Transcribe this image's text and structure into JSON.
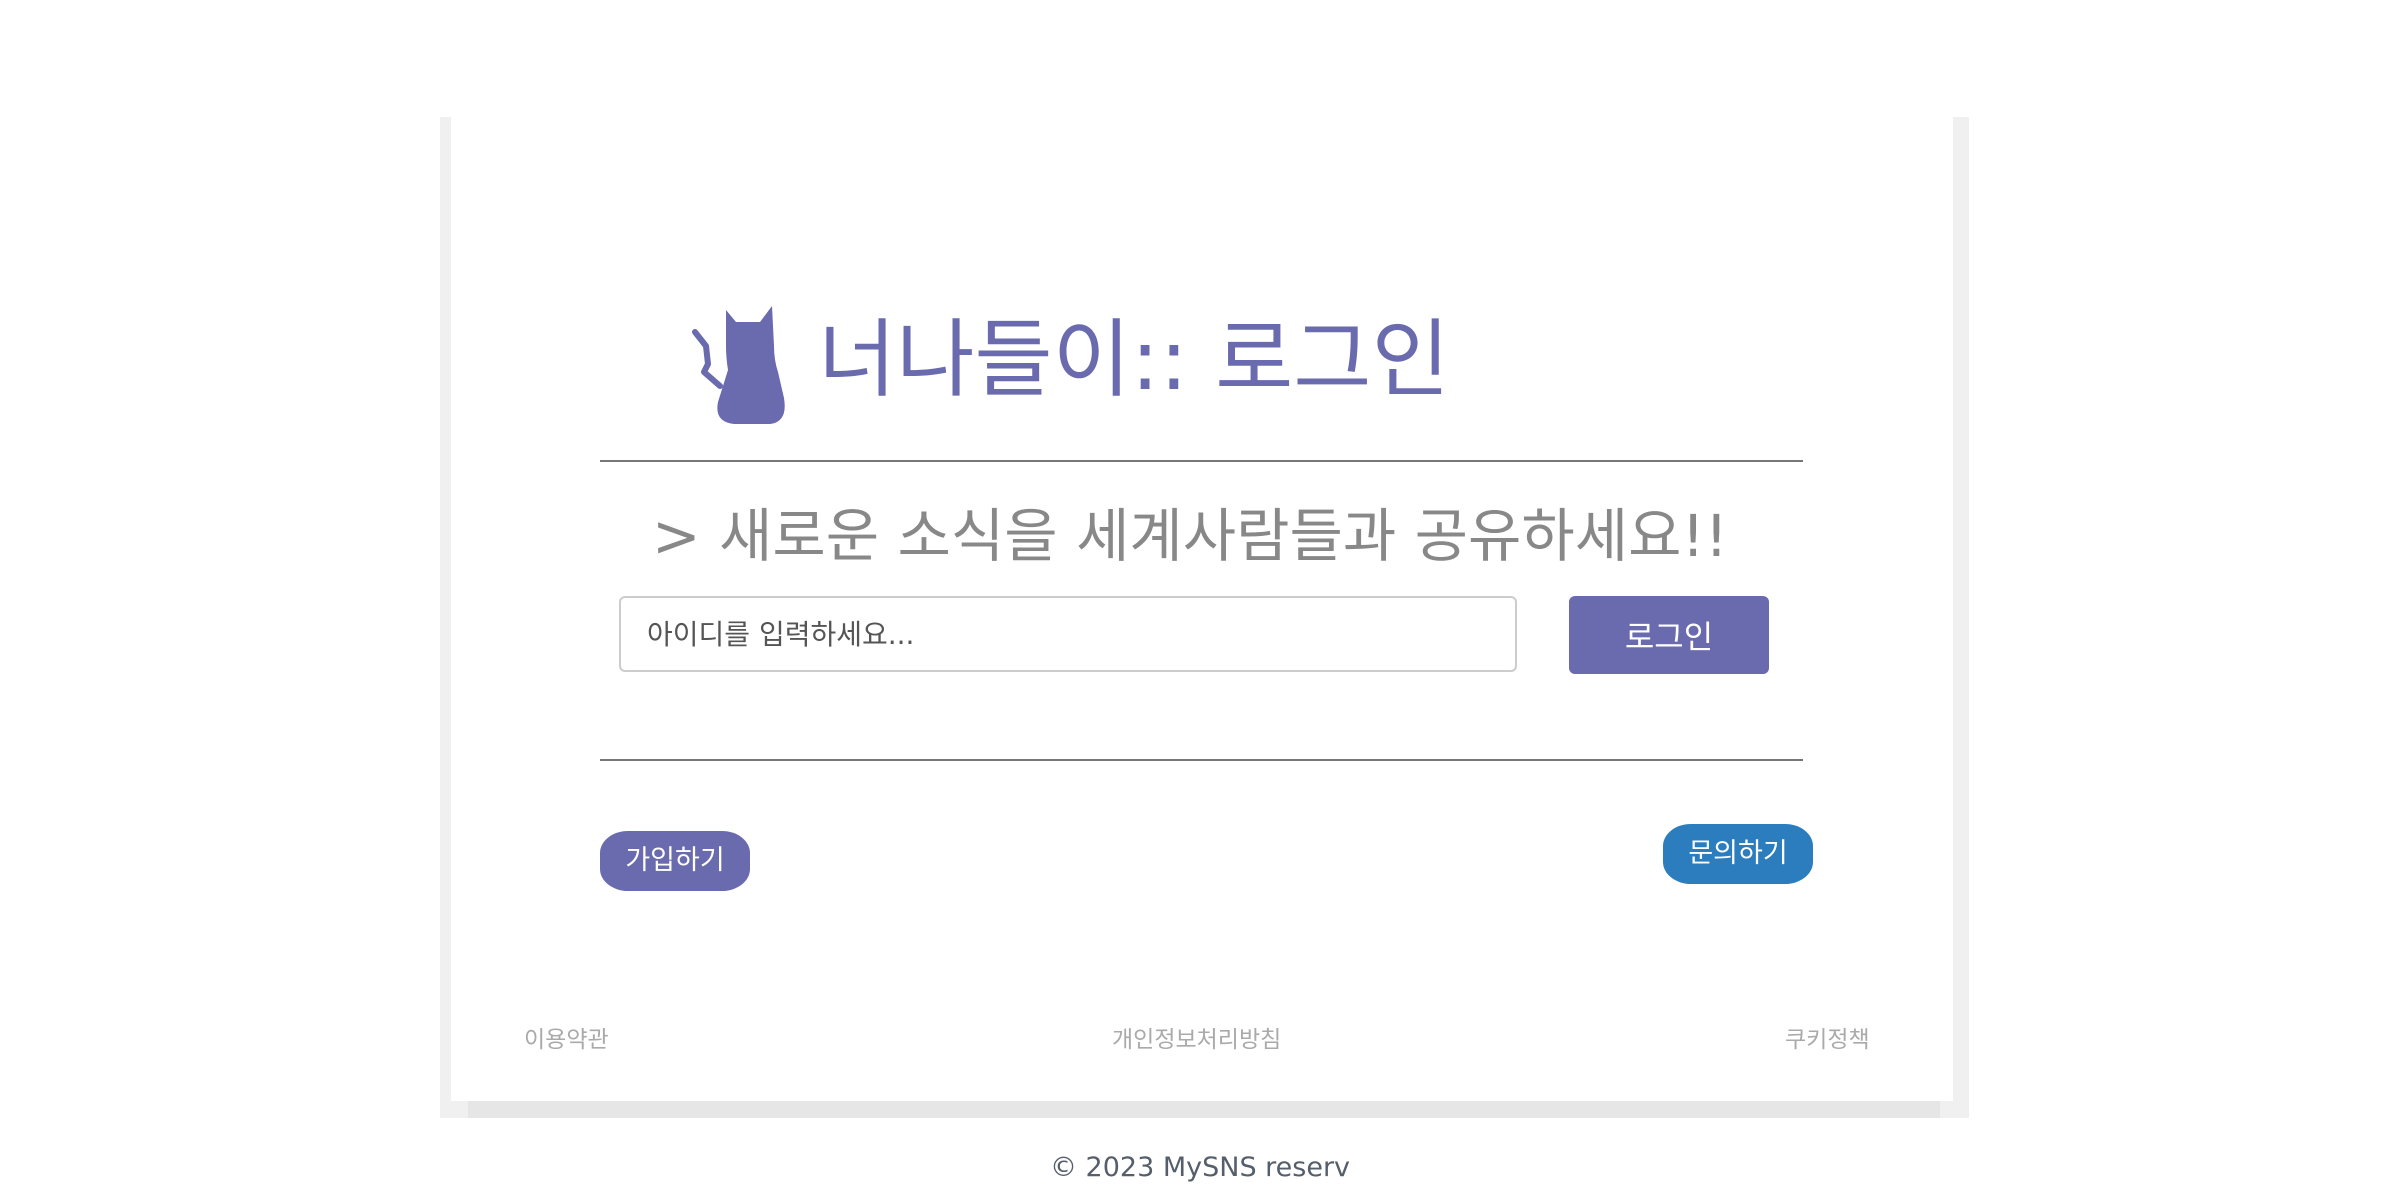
{
  "header": {
    "icon": "cat-icon",
    "title": "너나들이:: 로그인"
  },
  "tagline": "> 새로운 소식을 세계사람들과 공유하세요!!",
  "login": {
    "id_placeholder": "아이디를 입력하세요...",
    "id_value": "",
    "button_label": "로그인"
  },
  "actions": {
    "signup_label": "가입하기",
    "contact_label": "문의하기"
  },
  "footer": {
    "links": [
      "이용약관",
      "개인정보처리방침",
      "쿠키정책"
    ],
    "copyright": "© 2023 MySNS reserv"
  },
  "colors": {
    "primary": "#6a6aaf",
    "contact": "#2b7dbd",
    "muted_text": "#888888",
    "link_text": "#aaaaaa"
  }
}
